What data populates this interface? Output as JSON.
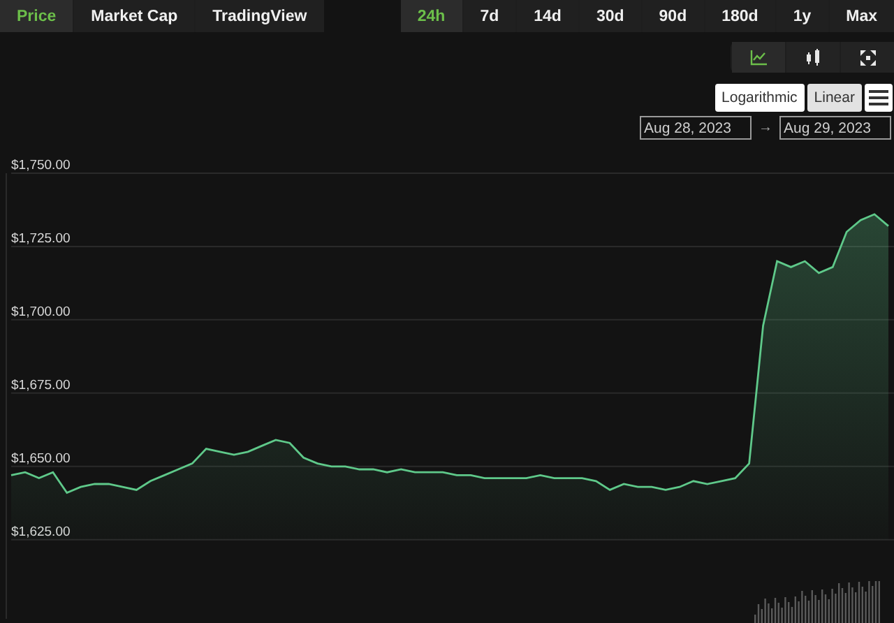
{
  "tabs": [
    {
      "label": "Price",
      "selected": true
    },
    {
      "label": "Market Cap",
      "selected": false
    },
    {
      "label": "TradingView",
      "selected": false
    }
  ],
  "ranges": [
    {
      "label": "24h",
      "selected": true
    },
    {
      "label": "7d",
      "selected": false
    },
    {
      "label": "14d",
      "selected": false
    },
    {
      "label": "30d",
      "selected": false
    },
    {
      "label": "90d",
      "selected": false
    },
    {
      "label": "180d",
      "selected": false
    },
    {
      "label": "1y",
      "selected": false
    },
    {
      "label": "Max",
      "selected": false
    }
  ],
  "chart_types": [
    {
      "kind": "line",
      "selected": true
    },
    {
      "kind": "candle",
      "selected": false
    },
    {
      "kind": "fullscreen",
      "selected": false
    }
  ],
  "scales": [
    {
      "label": "Logarithmic",
      "selected": false
    },
    {
      "label": "Linear",
      "selected": true
    }
  ],
  "date_range": {
    "from": "Aug 28, 2023",
    "arrow": "→",
    "to": "Aug 29, 2023"
  },
  "chart": {
    "chart_data": {
      "type": "area",
      "grid": true,
      "ylim": [
        1598,
        1750
      ],
      "yticks": [
        {
          "value": 1750,
          "label": "$1,750.00"
        },
        {
          "value": 1725,
          "label": "$1,725.00"
        },
        {
          "value": 1700,
          "label": "$1,700.00"
        },
        {
          "value": 1675,
          "label": "$1,675.00"
        },
        {
          "value": 1650,
          "label": "$1,650.00"
        },
        {
          "value": 1625,
          "label": "$1,625.00"
        }
      ],
      "series": [
        {
          "color": "#5fc98a",
          "values": [
            1647,
            1648,
            1646,
            1648,
            1641,
            1643,
            1644,
            1644,
            1643,
            1642,
            1645,
            1647,
            1649,
            1651,
            1656,
            1655,
            1654,
            1655,
            1657,
            1659,
            1658,
            1653,
            1651,
            1650,
            1650,
            1649,
            1649,
            1648,
            1649,
            1648,
            1648,
            1648,
            1647,
            1647,
            1646,
            1646,
            1646,
            1646,
            1647,
            1646,
            1646,
            1646,
            1645,
            1642,
            1644,
            1643,
            1643,
            1642,
            1643,
            1645,
            1644,
            1645,
            1646,
            1651,
            1698,
            1720,
            1718,
            1720,
            1716,
            1718,
            1730,
            1734,
            1736,
            1732
          ]
        }
      ]
    }
  }
}
